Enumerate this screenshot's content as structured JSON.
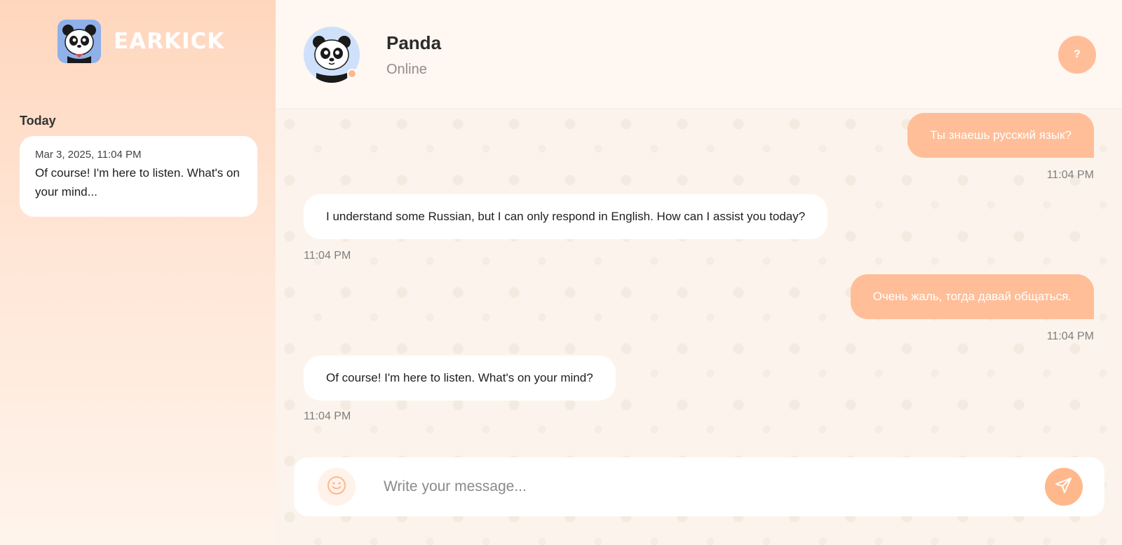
{
  "brand": {
    "name": "EARKICK",
    "logo_icon": "panda-logo-icon"
  },
  "sidebar": {
    "day_label": "Today",
    "sessions": [
      {
        "date": "Mar 3, 2025, 11:04 PM",
        "preview": "Of course! I'm here to listen. What's on your mind..."
      }
    ]
  },
  "header": {
    "contact_name": "Panda",
    "status": "Online",
    "help_label": "?"
  },
  "messages": [
    {
      "role": "user",
      "text": "Ты знаешь русский язык?",
      "time": "11:04 PM"
    },
    {
      "role": "bot",
      "text": "I understand some Russian, but I can only respond in English. How can I assist you today?",
      "time": "11:04 PM"
    },
    {
      "role": "user",
      "text": "Очень жаль, тогда давай общаться.",
      "time": "11:04 PM"
    },
    {
      "role": "bot",
      "text": "Of course! I'm here to listen. What's on your mind?",
      "time": "11:04 PM"
    }
  ],
  "composer": {
    "placeholder": "Write your message...",
    "emoji_icon": "smiley-icon",
    "send_icon": "paper-plane-icon"
  },
  "colors": {
    "accent": "#ffbe98",
    "sidebar_top": "#ffd6bd",
    "background": "#fdf6f0"
  }
}
